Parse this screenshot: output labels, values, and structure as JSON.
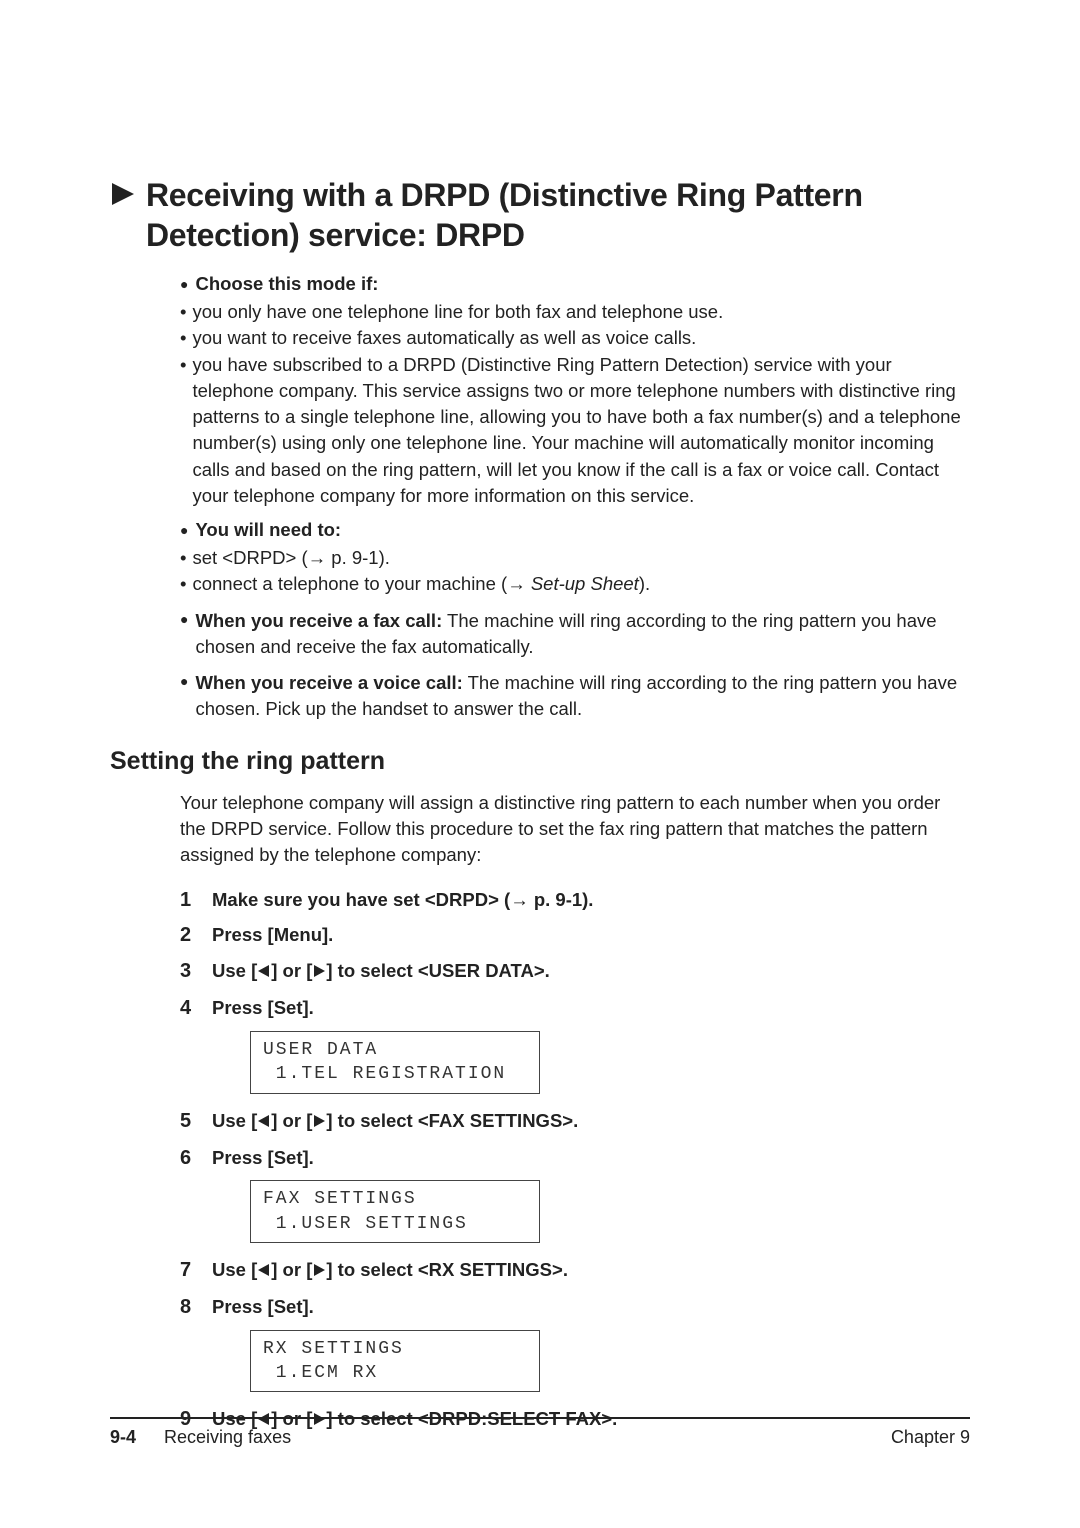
{
  "header": {
    "title": "Receiving with a DRPD (Distinctive Ring Pattern Detection) service: DRPD"
  },
  "blocks": {
    "choose_label": "Choose this mode if:",
    "choose_items": [
      "you only have one telephone line for both fax and telephone use.",
      "you want to receive faxes automatically as well as voice calls.",
      "you have subscribed to a DRPD (Distinctive Ring Pattern Detection) service with your telephone company. This service assigns two or more telephone numbers with distinctive ring patterns to a single telephone line, allowing you to have both a fax number(s) and a telephone number(s) using only one telephone line. Your machine will automatically monitor incoming calls and based on the ring pattern, will let you know if the call is a fax or voice call. Contact your telephone company for more information on this service."
    ],
    "need_label": "You will need to:",
    "need_item1_pre": "set <DRPD> (",
    "need_item1_post": " p. 9-1).",
    "need_item2_pre": "connect a telephone to your machine (",
    "need_item2_mid": "Set-up Sheet",
    "need_item2_post": ").",
    "fax_call_label": "When you receive a fax call:",
    "fax_call_text": " The machine will ring according to the ring pattern you have chosen and receive the fax automatically.",
    "voice_call_label": "When you receive a voice call:",
    "voice_call_text": " The machine will ring according to the ring pattern you have chosen. Pick up the handset to answer the call."
  },
  "subsection": {
    "heading": "Setting the ring pattern",
    "intro": "Your telephone company will assign a distinctive ring pattern to each number when you order the DRPD service. Follow this procedure to set the fax ring pattern that matches the pattern assigned by the telephone company:"
  },
  "steps": {
    "s1_pre": "Make sure you have set <DRPD> (",
    "s1_post": " p. 9-1).",
    "s2": "Press [Menu].",
    "s3_pre": "Use [",
    "s3_mid": "] or [",
    "s3_post": "] to select <USER DATA>.",
    "s4": "Press [Set].",
    "s5_pre": "Use [",
    "s5_mid": "] or [",
    "s5_post": "] to select <FAX SETTINGS>.",
    "s6": "Press [Set].",
    "s7_pre": "Use [",
    "s7_mid": "] or [",
    "s7_post": "] to select <RX SETTINGS>.",
    "s8": "Press [Set].",
    "s9_pre": "Use [",
    "s9_mid": "] or [",
    "s9_post": "] to select <DRPD:SELECT FAX>.",
    "n1": "1",
    "n2": "2",
    "n3": "3",
    "n4": "4",
    "n5": "5",
    "n6": "6",
    "n7": "7",
    "n8": "8",
    "n9": "9"
  },
  "lcd": {
    "d1": "USER DATA\n 1.TEL REGISTRATION",
    "d2": "FAX SETTINGS\n 1.USER SETTINGS",
    "d3": "RX SETTINGS\n 1.ECM RX"
  },
  "footer": {
    "page": "9-4",
    "left": "Receiving faxes",
    "right": "Chapter 9"
  }
}
